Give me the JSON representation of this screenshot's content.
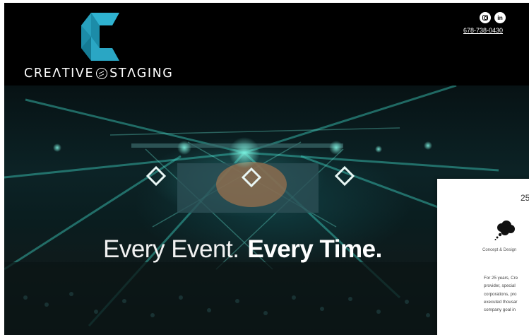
{
  "header": {
    "brand_left": "CRE",
    "brand_a": "Λ",
    "brand_mid": "TIVE",
    "brand_right": "ST",
    "brand_a2": "Λ",
    "brand_end": "GING",
    "phone": "678-738-0430",
    "icons": [
      "instagram-icon",
      "linkedin-icon"
    ],
    "linkedin_glyph": "in"
  },
  "hero": {
    "tagline_light": "Every Event.",
    "tagline_bold": "Every Time."
  },
  "panel": {
    "heading": "25",
    "icon": "thought-cloud-icon",
    "label": "Concept & Design",
    "text_lines": [
      "For 25 years, Cre",
      "provider,  special",
      "corporations,  pro",
      "executed thousar",
      "company goal in"
    ]
  },
  "colors": {
    "header_bg": "#000000",
    "logo_teal_light": "#2aa6c4",
    "logo_teal_dark": "#12758f",
    "hero_light": "#3fd1c2"
  }
}
